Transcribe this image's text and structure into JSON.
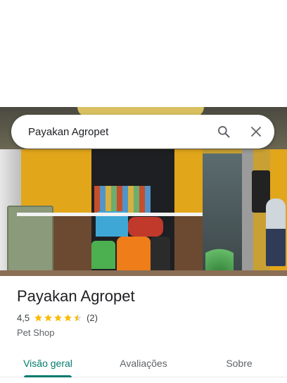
{
  "search": {
    "query": "Payakan Agropet",
    "search_icon": "search-icon",
    "clear_icon": "close-icon"
  },
  "place": {
    "name": "Payakan Agropet",
    "rating": "4,5",
    "rating_value": 4.5,
    "stars_max": 5,
    "review_count": "(2)",
    "category": "Pet Shop"
  },
  "tabs": [
    {
      "label": "Visão geral",
      "active": true
    },
    {
      "label": "Avaliações",
      "active": false
    },
    {
      "label": "Sobre",
      "active": false
    }
  ],
  "colors": {
    "accent": "#00796b",
    "star": "#fbbc04"
  }
}
